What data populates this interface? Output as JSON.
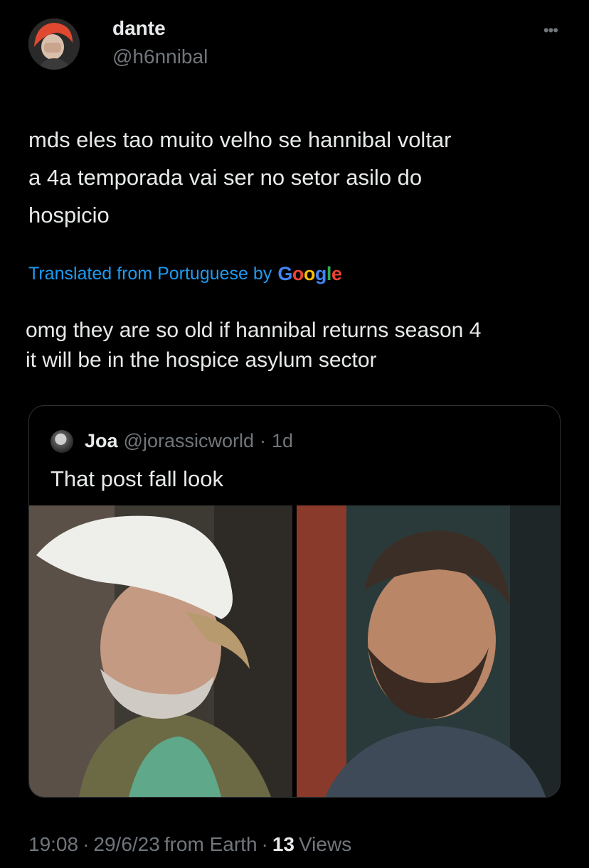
{
  "author": {
    "display_name": "dante",
    "handle": "@h6nnibal",
    "avatar_icon": "user-avatar"
  },
  "more_icon": "more-dots-icon",
  "tweet": {
    "text": "mds eles tao muito velho se hannibal voltar\na 4a temporada vai ser no setor asilo do\nhospicio",
    "translated_label": "Translated from Portuguese by",
    "translator_brand": "Google",
    "translation": "omg they are so old if hannibal returns season 4\nit will be in the hospice asylum sector"
  },
  "quote": {
    "name": "Joa",
    "handle": "@jorassicworld",
    "separator": "·",
    "time": "1d",
    "text": "That post fall look",
    "images": [
      "older-man-white-cap-photo",
      "bearded-man-photo"
    ]
  },
  "footer": {
    "time": "19:08",
    "sep1": "·",
    "date": "29/6/23",
    "source": "from Earth",
    "sep2": "·",
    "views_count": "13",
    "views_label": "Views"
  },
  "colors": {
    "background": "#000000",
    "text": "#e7e9ea",
    "muted": "#71767b",
    "link": "#1d9bf0",
    "border": "#2f3336"
  }
}
